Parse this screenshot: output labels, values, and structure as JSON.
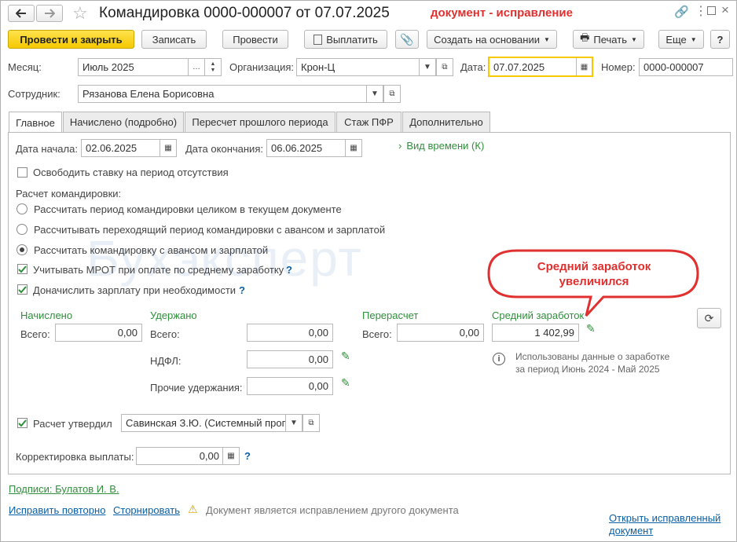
{
  "window": {
    "title": "Командировка 0000-000007 от 07.07.2025",
    "status_note": "документ - исправление"
  },
  "toolbar": {
    "post_close": "Провести и закрыть",
    "save": "Записать",
    "post": "Провести",
    "pay": "Выплатить",
    "create_based": "Создать на основании",
    "print": "Печать",
    "more": "Еще",
    "help": "?"
  },
  "header": {
    "month_label": "Месяц:",
    "month_value": "Июль 2025",
    "org_label": "Организация:",
    "org_value": "Крон-Ц",
    "date_label": "Дата:",
    "date_value": "07.07.2025",
    "number_label": "Номер:",
    "number_value": "0000-000007",
    "employee_label": "Сотрудник:",
    "employee_value": "Рязанова Елена Борисовна"
  },
  "tabs": [
    {
      "label": "Главное"
    },
    {
      "label": "Начислено (подробно)"
    },
    {
      "label": "Пересчет прошлого периода"
    },
    {
      "label": "Стаж ПФР"
    },
    {
      "label": "Дополнительно"
    }
  ],
  "main": {
    "start_label": "Дата начала:",
    "start_value": "02.06.2025",
    "end_label": "Дата окончания:",
    "end_value": "06.06.2025",
    "time_type": "Вид времени (К)",
    "free_rate": "Освободить ставку на период отсутствия",
    "calc_label": "Расчет командировки:",
    "radio_1": "Рассчитать период командировки целиком в текущем документе",
    "radio_2": "Рассчитывать переходящий период командировки с авансом и зарплатой",
    "radio_3": "Рассчитать командировку с авансом и зарплатой",
    "mrot": "Учитывать МРОТ при оплате по среднему заработку",
    "topup": "Доначислить зарплату при необходимости",
    "q": "?"
  },
  "totals": {
    "accrued_header": "Начислено",
    "withheld_header": "Удержано",
    "recalc_header": "Перерасчет",
    "avg_header": "Средний заработок",
    "total_label": "Всего:",
    "accrued_total": "0,00",
    "withheld_total": "0,00",
    "ndfl_label": "НДФЛ:",
    "ndfl_value": "0,00",
    "other_label": "Прочие удержания:",
    "other_value": "0,00",
    "recalc_total": "0,00",
    "avg_value": "1 402,99",
    "info_text_1": "Использованы данные о заработке",
    "info_text_2": "за период Июнь 2024 - Май 2025"
  },
  "callout": {
    "line1": "Средний заработок",
    "line2": "увеличился"
  },
  "watermark": "Бухэксперт",
  "approval": {
    "label": "Расчет утвердил",
    "value": "Савинская З.Ю. (Системный прог"
  },
  "adjust": {
    "label": "Корректировка выплаты:",
    "value": "0,00"
  },
  "footer": {
    "signatures": "Подписи: Булатов И. В.",
    "fix_again": "Исправить повторно",
    "reverse": "Сторнировать",
    "warning": "Документ является исправлением другого документа",
    "open_fixed_1": "Открыть исправленный",
    "open_fixed_2": "документ"
  },
  "colors": {
    "accent_yellow": "#f5c800",
    "status_red": "#e0302f",
    "label_green": "#2f8f3a",
    "link_blue": "#0b5fa5"
  }
}
